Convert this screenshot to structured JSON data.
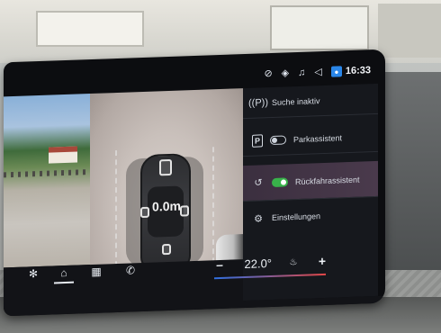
{
  "status_bar": {
    "clock": "16:33",
    "icons": [
      "antenna-off-icon",
      "connected-car-icon",
      "music-note-icon",
      "speaker-icon",
      "user-profile-icon"
    ]
  },
  "camera": {
    "distance_readout": "0.0m"
  },
  "menu": {
    "items": [
      {
        "label": "Suche inaktiv",
        "icon": "parking-search-icon"
      },
      {
        "label": "Parkassistent",
        "icon": "p-parking-icon",
        "toggle": "off"
      },
      {
        "label": "Rückfahrassistent",
        "icon": "reverse-assist-icon",
        "toggle": "on"
      },
      {
        "label": "Einstellungen",
        "icon": "gear-icon"
      }
    ]
  },
  "bottom_nav": {
    "items": [
      "fan-icon",
      "home-icon",
      "apps-grid-icon",
      "phone-icon"
    ]
  },
  "climate": {
    "minus": "–",
    "temperature": "22.0°",
    "plus": "+"
  },
  "colors": {
    "toggle_on": "#38b24a",
    "highlight_row": "#4a3a4c",
    "temp_cold": "#2f6fe0",
    "temp_warm": "#e24747"
  }
}
